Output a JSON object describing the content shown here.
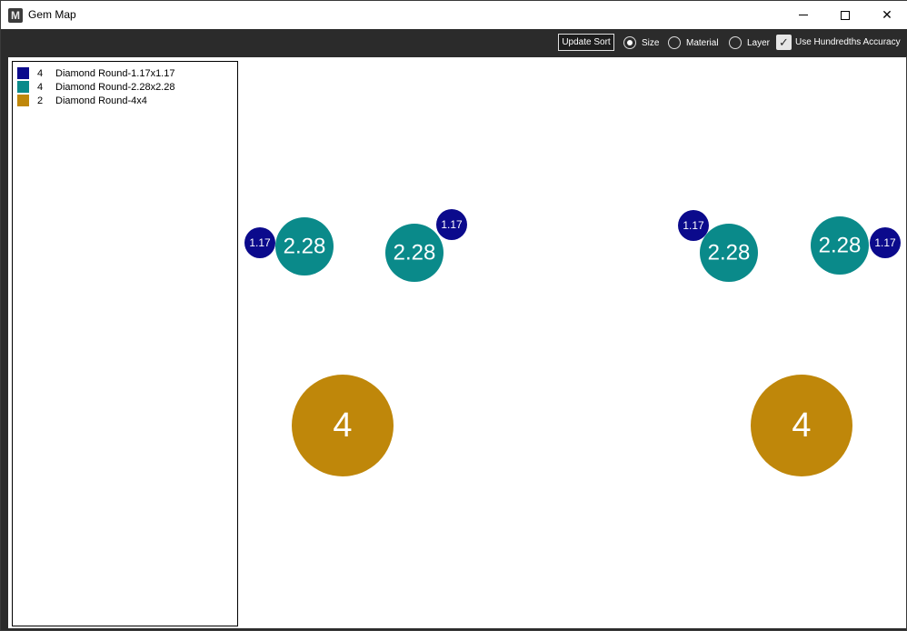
{
  "window": {
    "title": "Gem Map",
    "app_icon_letter": "M"
  },
  "toolbar": {
    "update_sort_label": "Update Sort",
    "sort_options": [
      {
        "label": "Size",
        "selected": true
      },
      {
        "label": "Material",
        "selected": false
      },
      {
        "label": "Layer",
        "selected": false
      }
    ],
    "hundredths_label": "Use Hundredths Accuracy",
    "hundredths_checked": true
  },
  "legend": [
    {
      "count": "4",
      "name": "Diamond Round-1.17x1.17",
      "color": "#0b0a8c"
    },
    {
      "count": "4",
      "name": "Diamond Round-2.28x2.28",
      "color": "#0a8a8a"
    },
    {
      "count": "2",
      "name": "Diamond Round-4x4",
      "color": "#bf870a"
    }
  ],
  "gems": [
    {
      "label": "1.17",
      "color": "#0b0a8c",
      "size": 1.17
    },
    {
      "label": "2.28",
      "color": "#0a8a8a",
      "size": 2.28
    },
    {
      "label": "2.28",
      "color": "#0a8a8a",
      "size": 2.28
    },
    {
      "label": "1.17",
      "color": "#0b0a8c",
      "size": 1.17
    },
    {
      "label": "1.17",
      "color": "#0b0a8c",
      "size": 1.17
    },
    {
      "label": "2.28",
      "color": "#0a8a8a",
      "size": 2.28
    },
    {
      "label": "2.28",
      "color": "#0a8a8a",
      "size": 2.28
    },
    {
      "label": "1.17",
      "color": "#0b0a8c",
      "size": 1.17
    },
    {
      "label": "4",
      "color": "#bf870a",
      "size": 4
    },
    {
      "label": "4",
      "color": "#bf870a",
      "size": 4
    }
  ]
}
